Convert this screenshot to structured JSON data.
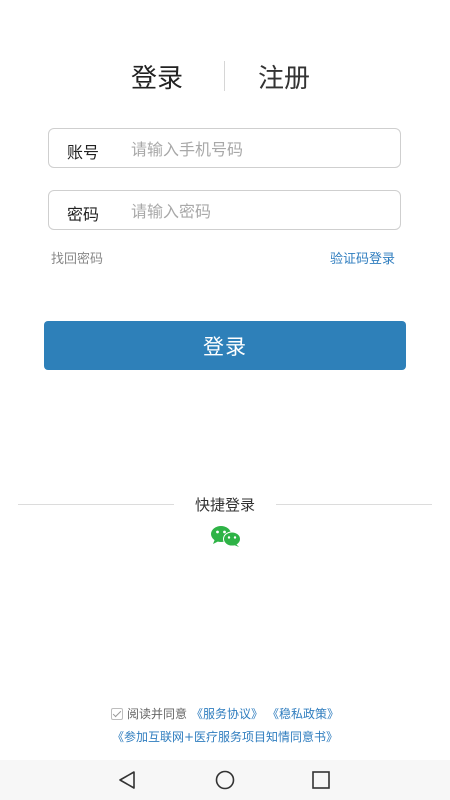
{
  "tabs": {
    "login": "登录",
    "register": "注册"
  },
  "form": {
    "account_label": "账号",
    "account_placeholder": "请输入手机号码",
    "account_value": "",
    "password_label": "密码",
    "password_placeholder": "请输入密码",
    "password_value": ""
  },
  "links": {
    "recover_password": "找回密码",
    "sms_login": "验证码登录"
  },
  "login_button": "登录",
  "quick_login": {
    "title": "快捷登录",
    "icon": "wechat-icon"
  },
  "agreement": {
    "checked": true,
    "prefix": "阅读并同意",
    "service_link": "《服务协议》",
    "privacy_link": "《稳私政策》",
    "consent_link": "《参加互联网+医疗服务项目知情同意书》"
  },
  "navbar": {
    "back_icon": "back-triangle-icon",
    "home_icon": "home-circle-icon",
    "recent_icon": "recent-square-icon"
  },
  "colors": {
    "primary": "#2e80b9",
    "link": "#2f7dbf",
    "wechat": "#2eb346"
  }
}
